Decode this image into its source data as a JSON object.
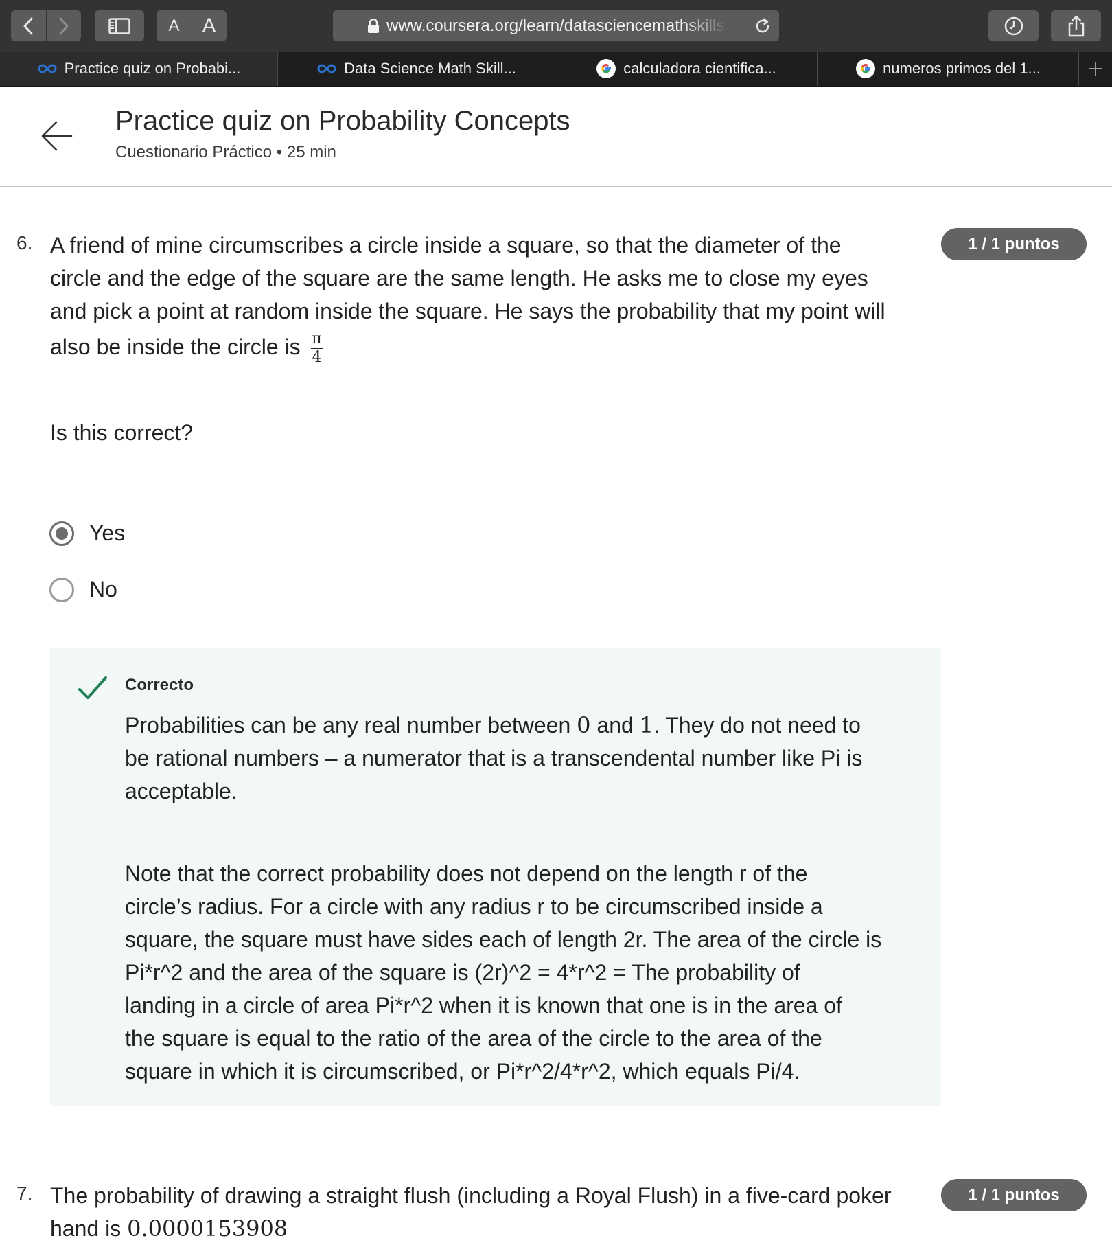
{
  "browser": {
    "url": "www.coursera.org/learn/datasciencemathskills",
    "font_small_label": "A",
    "font_large_label": "A",
    "tabs": [
      {
        "label": "Practice quiz on Probabi...",
        "icon": "coursera-icon"
      },
      {
        "label": "Data Science Math Skill...",
        "icon": "coursera-icon"
      },
      {
        "label": "calculadora cientifica...",
        "icon": "google-icon"
      },
      {
        "label": "numeros primos del 1...",
        "icon": "google-icon"
      }
    ],
    "colors": {
      "toolbar": "#333335",
      "tab_strip": "#1e1e1f",
      "coursera_blue": "#2a73cc"
    }
  },
  "header": {
    "title": "Practice quiz on Probability Concepts",
    "subtitle": "Cuestionario Práctico • 25 min"
  },
  "question6": {
    "number": "6.",
    "badge": "1 / 1 puntos",
    "lines": [
      "A friend of mine circumscribes a circle inside a square, so that the diameter of the",
      "circle and the edge of the square are the same length. He asks me to close my eyes",
      "and pick a point at random inside the square. He says the probability that my point will",
      "also be inside the circle is"
    ],
    "fraction_numerator": "π",
    "fraction_denominator": "4",
    "prompt": "Is this correct?",
    "options": [
      {
        "label": "Yes",
        "selected": true
      },
      {
        "label": "No",
        "selected": false
      }
    ],
    "feedback": {
      "title": "Correcto",
      "p1_lines": [
        [
          "Probabilities can be any real number between ",
          "0",
          " and ",
          "1",
          ". They do not need to"
        ],
        "be rational numbers – a numerator that is a transcendental number like Pi is",
        "acceptable."
      ],
      "p2_lines": [
        "Note that the correct probability does not depend on the length r of the",
        "circle’s radius. For a circle with any radius r to be circumscribed inside a",
        "square, the square must have sides each of length 2r. The area of the circle is",
        "Pi*r^2 and the area of the square is (2r)^2 = 4*r^2 = The probability of",
        "landing in a circle of area Pi*r^2 when it is known that one is in the area of",
        "the square is equal to the ratio of the area of the circle to the area of the",
        "square in which it is circumscribed, or Pi*r^2/4*r^2, which equals Pi/4."
      ],
      "colors": {
        "background": "#f2f8f6",
        "check": "#1f8354"
      }
    }
  },
  "question7": {
    "number": "7.",
    "badge": "1 / 1 puntos",
    "line1": "The probability of drawing a straight flush (including a Royal Flush) in a five-card poker",
    "line2_prefix": "hand is ",
    "line2_value": "0.0000153908"
  }
}
